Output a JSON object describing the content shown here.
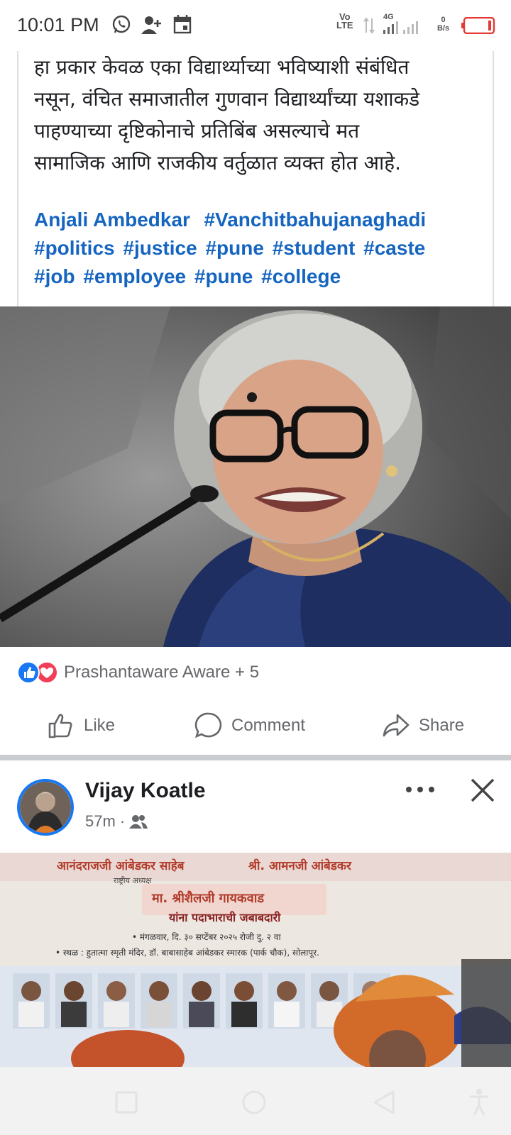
{
  "status_bar": {
    "time": "10:01 PM",
    "network_top": "Vo",
    "network_bottom": "LTE",
    "network_type": "4G",
    "speed_value": "0",
    "speed_unit": "B/s",
    "icons": [
      "whatsapp-icon",
      "add-contact-icon",
      "calendar-icon",
      "signal-icon",
      "battery-low-icon"
    ]
  },
  "post": {
    "text_lines": [
      "हा प्रकार केवळ एका विद्यार्थ्याच्या भविष्याशी संबंधित",
      "नसून, वंचित समाजातील गुणवान विद्यार्थ्यांच्या यशाकडे",
      "पाहण्याच्या दृष्टिकोनाचे प्रतिबिंब असल्याचे मत",
      "सामाजिक आणि राजकीय वर्तुळात व्यक्त होत आहे."
    ],
    "tags": {
      "line1": [
        "Anjali Ambedkar",
        "#Vanchitbahujanaghadi"
      ],
      "line2": [
        "#politics",
        "#justice",
        "#pune",
        "#student",
        "#caste"
      ],
      "line3": [
        "#job",
        "#employee",
        "#pune",
        "#college"
      ]
    },
    "reactions_text": "Prashantaware Aware + 5",
    "actions": {
      "like": "Like",
      "comment": "Comment",
      "share": "Share"
    }
  },
  "next_post": {
    "author": "Vijay Koatle",
    "time": "57m ·",
    "banner": {
      "line1": "आनंदराजजी आंबेडकर साहेब",
      "line1b": "श्री. आमनजी आंबेडकर",
      "line2": "राष्ट्रीय अध्यक्ष",
      "line3": "मा. श्रीशैलजी गायकवाड",
      "line4": "यांना पदाभाराची जबाबदारी",
      "line5": "• मंगळवार, दि. ३० सप्टेंबर २०२५ रोजी दु. २ वा",
      "line6": "• स्थळ : हुतात्मा स्मृती मंदिर, डॉ. बाबासाहेब आंबेडकर स्मारक (पार्क चौक), सोलापूर."
    }
  },
  "colors": {
    "link_blue": "#1565c0",
    "facebook_blue": "#1877f2",
    "love_red": "#f33e58",
    "muted_text": "#65676b"
  }
}
